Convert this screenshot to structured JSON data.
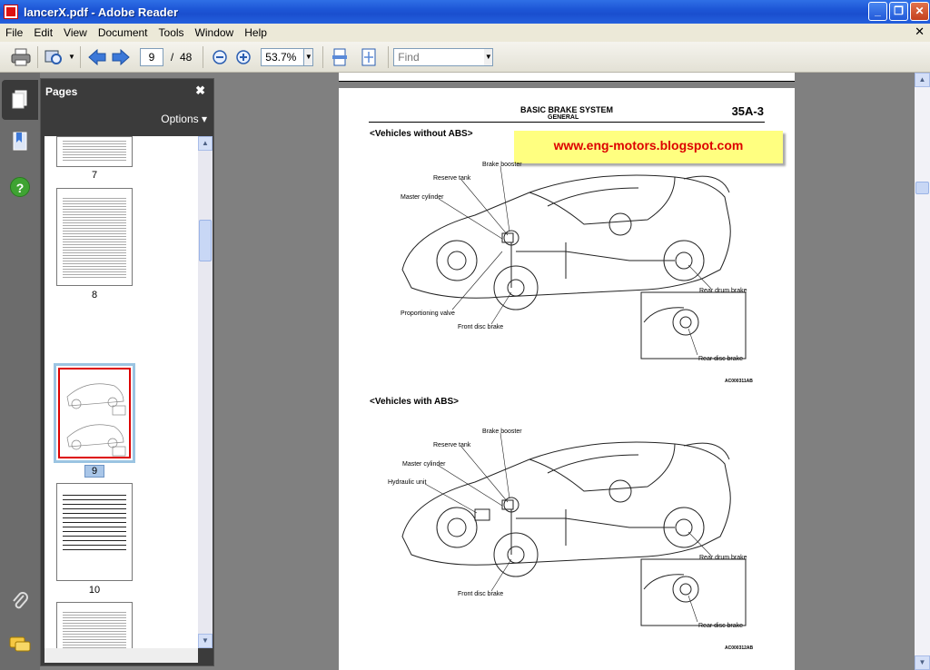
{
  "window": {
    "title": "lancerX.pdf - Adobe Reader",
    "min_glyph": "_",
    "max_glyph": "❐",
    "close_glyph": "✕"
  },
  "menu": {
    "items": [
      "File",
      "Edit",
      "View",
      "Document",
      "Tools",
      "Window",
      "Help"
    ],
    "close_glyph": "✕"
  },
  "toolbar": {
    "current_page": "9",
    "page_separator": "/",
    "total_pages": "48",
    "zoom": "53.7%",
    "find_placeholder": "Find"
  },
  "panel": {
    "title": "Pages",
    "options": "Options ▾",
    "close_glyph": "✖",
    "thumbnails": [
      "7",
      "8",
      "9",
      "10"
    ],
    "selected": "9"
  },
  "page": {
    "header_title": "BASIC BRAKE SYSTEM",
    "header_sub": "GENERAL",
    "page_number": "35A-3",
    "watermark": "www.eng-motors.blogspot.com",
    "section1": {
      "heading": "<Vehicles without ABS>",
      "labels": [
        "Brake booster",
        "Reserve tank",
        "Master cylinder",
        "Proportioning valve",
        "Front disc brake",
        "Rear drum brake",
        "Rear disc brake"
      ],
      "figure_id": "AC000311AB"
    },
    "section2": {
      "heading": "<Vehicles with ABS>",
      "labels": [
        "Brake booster",
        "Reserve tank",
        "Master cylinder",
        "Hydraulic unit",
        "Front disc brake",
        "Rear drum brake",
        "Rear disc brake"
      ],
      "figure_id": "AC000312AB"
    }
  },
  "icons": {
    "print": "printer-icon",
    "search": "search-icon",
    "prev": "arrow-left-icon",
    "next": "arrow-right-icon",
    "zoom_out": "zoom-out-icon",
    "zoom_in": "zoom-in-icon",
    "fit_page": "fit-page-icon",
    "fit_width": "fit-width-icon",
    "pages": "pages-icon",
    "bookmarks": "bookmark-icon",
    "help": "help-icon",
    "attach": "paperclip-icon",
    "comments": "comments-icon"
  }
}
